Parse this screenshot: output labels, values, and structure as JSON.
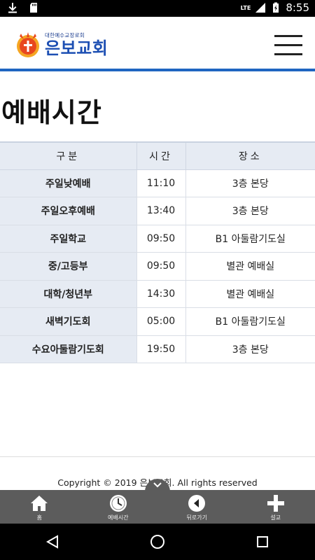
{
  "status_bar": {
    "time": "8:55",
    "network": "LTE",
    "icons": [
      "download-icon",
      "sd-card-icon",
      "signal-icon",
      "battery-icon"
    ]
  },
  "header": {
    "logo_subtitle": "대한예수교장로회",
    "logo_title": "은보교회",
    "brand_color": "#1d4fb3",
    "accent_color": "#1f66c1"
  },
  "page": {
    "title": "예배시간"
  },
  "table": {
    "headers": [
      "구분",
      "시간",
      "장소"
    ],
    "rows": [
      {
        "category": "주일낮예배",
        "time": "11:10",
        "place": "3층 본당"
      },
      {
        "category": "주일오후예배",
        "time": "13:40",
        "place": "3층 본당"
      },
      {
        "category": "주일학교",
        "time": "09:50",
        "place": "B1 아둘람기도실"
      },
      {
        "category": "중/고등부",
        "time": "09:50",
        "place": "별관 예배실"
      },
      {
        "category": "대학/청년부",
        "time": "14:30",
        "place": "별관 예배실"
      },
      {
        "category": "새벽기도회",
        "time": "05:00",
        "place": "B1 아둘람기도실"
      },
      {
        "category": "수요아둘람기도회",
        "time": "19:50",
        "place": "3층 본당"
      }
    ]
  },
  "footer": {
    "copyright": "Copyright © 2019 은보교회. All rights reserved"
  },
  "tabbar": {
    "items": [
      {
        "label": "홈",
        "icon": "home-icon"
      },
      {
        "label": "예배시간",
        "icon": "clock-icon"
      },
      {
        "label": "뒤로가기",
        "icon": "back-arrow-icon"
      },
      {
        "label": "설교",
        "icon": "plus-icon"
      }
    ]
  },
  "navbar": {
    "icons": [
      "back-triangle-icon",
      "home-circle-icon",
      "recents-square-icon"
    ]
  }
}
